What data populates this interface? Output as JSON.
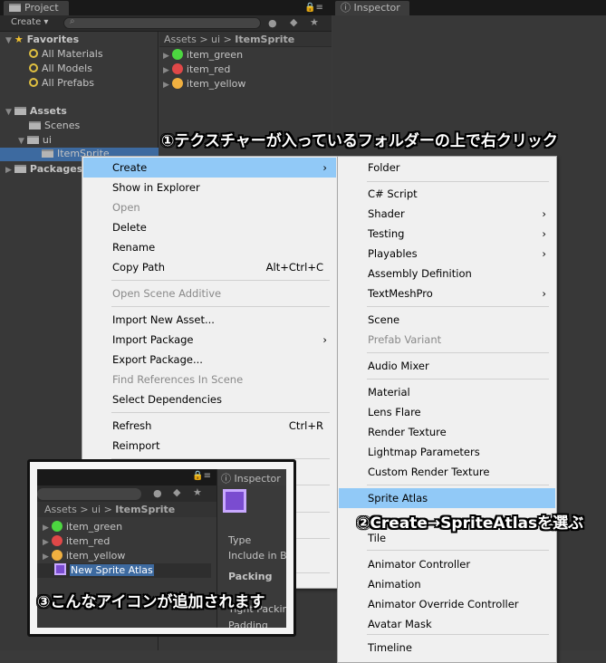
{
  "tabs": {
    "project": "Project",
    "inspector": "Inspector"
  },
  "toolbar": {
    "create": "Create ▾",
    "search_placeholder": ""
  },
  "favorites": {
    "label": "Favorites",
    "items": [
      "All Materials",
      "All Models",
      "All Prefabs"
    ]
  },
  "tree": {
    "assets": "Assets",
    "scenes": "Scenes",
    "ui": "ui",
    "itemsprite": "ItemSprite",
    "packages": "Packages"
  },
  "breadcrumb": {
    "a": "Assets",
    "b": "ui",
    "c": "ItemSprite",
    "sep": ">"
  },
  "files": [
    {
      "name": "item_green",
      "color": "#4cd640"
    },
    {
      "name": "item_red",
      "color": "#e04848"
    },
    {
      "name": "item_yellow",
      "color": "#f0b040"
    }
  ],
  "context_menu": [
    {
      "label": "Create",
      "arrow": "›",
      "highlight": true
    },
    {
      "label": "Show in Explorer"
    },
    {
      "label": "Open",
      "disabled": true
    },
    {
      "label": "Delete"
    },
    {
      "label": "Rename"
    },
    {
      "label": "Copy Path",
      "shortcut": "Alt+Ctrl+C"
    },
    {
      "label": "Open Scene Additive",
      "disabled": true
    },
    {
      "label": "Import New Asset..."
    },
    {
      "label": "Import Package",
      "arrow": "›"
    },
    {
      "label": "Export Package..."
    },
    {
      "label": "Find References In Scene",
      "disabled": true
    },
    {
      "label": "Select Dependencies"
    },
    {
      "label": "Refresh",
      "shortcut": "Ctrl+R"
    },
    {
      "label": "Reimport"
    }
  ],
  "create_menu": [
    {
      "label": "Folder"
    },
    {
      "label": "C# Script"
    },
    {
      "label": "Shader",
      "arrow": "›"
    },
    {
      "label": "Testing",
      "arrow": "›"
    },
    {
      "label": "Playables",
      "arrow": "›"
    },
    {
      "label": "Assembly Definition"
    },
    {
      "label": "TextMeshPro",
      "arrow": "›"
    },
    {
      "label": "Scene"
    },
    {
      "label": "Prefab Variant",
      "disabled": true
    },
    {
      "label": "Audio Mixer"
    },
    {
      "label": "Material"
    },
    {
      "label": "Lens Flare"
    },
    {
      "label": "Render Texture"
    },
    {
      "label": "Lightmap Parameters"
    },
    {
      "label": "Custom Render Texture"
    },
    {
      "label": "Sprite Atlas",
      "highlight": true
    },
    {
      "label": "Tile"
    },
    {
      "label": "Animator Controller"
    },
    {
      "label": "Animation"
    },
    {
      "label": "Animator Override Controller"
    },
    {
      "label": "Avatar Mask"
    },
    {
      "label": "Timeline"
    }
  ],
  "captions": {
    "step1": "①テクスチャーが入っているフォルダーの上で右クリック",
    "step2": "②Create→SpriteAtlasを選ぶ",
    "step3": "③こんなアイコンが追加されます"
  },
  "inset": {
    "new_asset": "New Sprite Atlas",
    "inspector": "Inspector",
    "type": "Type",
    "include": "Include in B",
    "packing": "Packing",
    "tight": "Tight Packing",
    "padding": "Padding"
  }
}
